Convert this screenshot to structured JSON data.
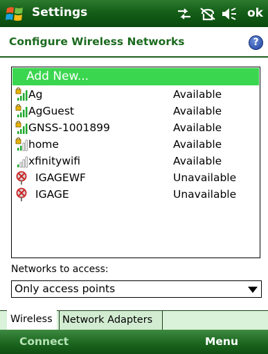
{
  "titlebar": {
    "title": "Settings",
    "ok_label": "ok",
    "icons": [
      "windows-flag-icon",
      "connectivity-icon",
      "phone-off-icon",
      "speaker-icon"
    ]
  },
  "header": {
    "title": "Configure Wireless Networks",
    "help_label": "?"
  },
  "networks": {
    "add_new_label": "Add New...",
    "items": [
      {
        "name": "Ag",
        "status": "Available",
        "icon": "locked-signal-strong-icon"
      },
      {
        "name": "AgGuest",
        "status": "Available",
        "icon": "locked-signal-strong-icon"
      },
      {
        "name": "GNSS-1001899",
        "status": "Available",
        "icon": "locked-signal-strong-icon"
      },
      {
        "name": "home",
        "status": "Available",
        "icon": "locked-signal-weak-icon"
      },
      {
        "name": "xfinitywifi",
        "status": "Available",
        "icon": "signal-weak-icon"
      },
      {
        "name": "IGAGEWF",
        "status": "Unavailable",
        "icon": "unavailable-network-icon"
      },
      {
        "name": "IGAGE",
        "status": "Unavailable",
        "icon": "unavailable-network-icon"
      }
    ]
  },
  "access": {
    "label": "Networks to access:",
    "selected": "Only access points"
  },
  "tabs": [
    {
      "label": "Wireless",
      "active": true
    },
    {
      "label": "Network Adapters",
      "active": false
    }
  ],
  "softkeys": {
    "left": "Connect",
    "right": "Menu"
  },
  "colors": {
    "brand_green": "#1c6a1f",
    "highlight_green": "#3bd64f",
    "tab_strip": "#d9f2d9"
  }
}
